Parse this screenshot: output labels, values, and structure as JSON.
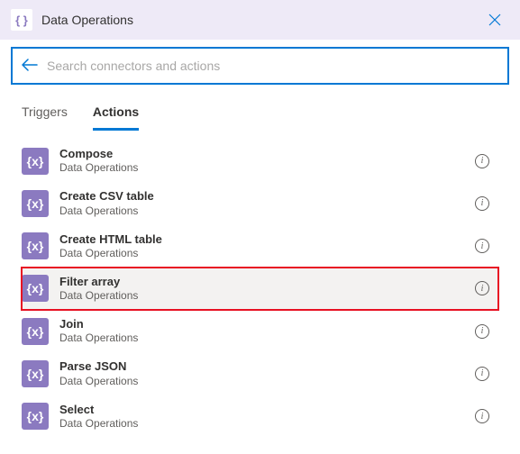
{
  "header": {
    "title": "Data Operations",
    "icon_glyph": "{ }"
  },
  "search": {
    "placeholder": "Search connectors and actions",
    "value": ""
  },
  "tabs": {
    "triggers": "Triggers",
    "actions": "Actions",
    "active": "actions"
  },
  "actions": [
    {
      "title": "Compose",
      "subtitle": "Data Operations",
      "highlighted": false
    },
    {
      "title": "Create CSV table",
      "subtitle": "Data Operations",
      "highlighted": false
    },
    {
      "title": "Create HTML table",
      "subtitle": "Data Operations",
      "highlighted": false
    },
    {
      "title": "Filter array",
      "subtitle": "Data Operations",
      "highlighted": true
    },
    {
      "title": "Join",
      "subtitle": "Data Operations",
      "highlighted": false
    },
    {
      "title": "Parse JSON",
      "subtitle": "Data Operations",
      "highlighted": false
    },
    {
      "title": "Select",
      "subtitle": "Data Operations",
      "highlighted": false
    }
  ],
  "icon_glyph": "{x}"
}
